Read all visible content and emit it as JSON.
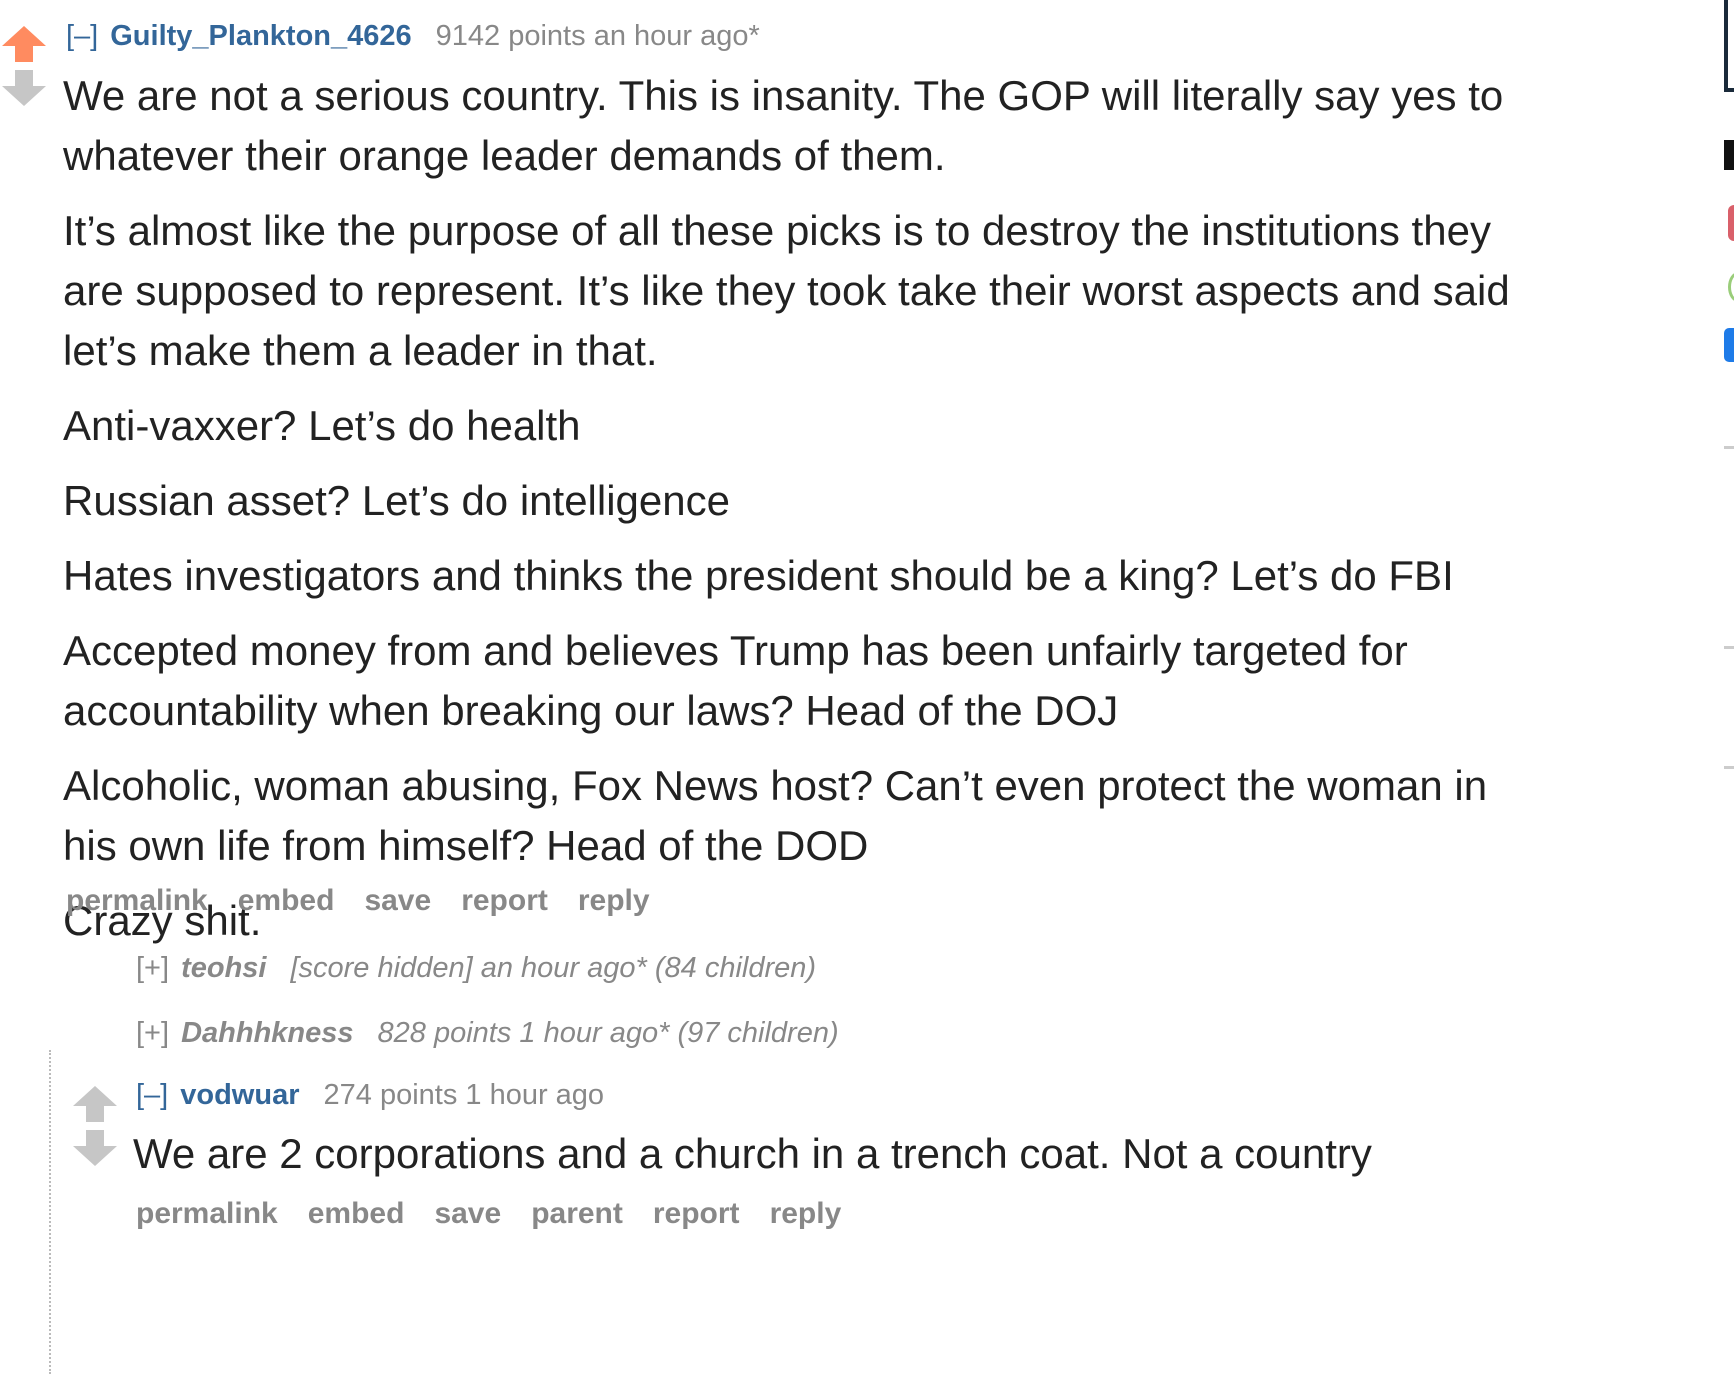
{
  "comment_main": {
    "toggle": "[–]",
    "author": "Guilty_Plankton_4626",
    "score": "9142 points",
    "time": "an hour ago*",
    "paragraphs": [
      "We are not a serious country. This is insanity. The GOP will literally say yes to whatever their orange leader demands of them.",
      "It’s almost like the purpose of all these picks is to destroy the institutions they are supposed to represent. It’s like they took take their worst aspects and said let’s make them a leader in that.",
      "Anti-vaxxer? Let’s do health",
      "Russian asset? Let’s do intelligence",
      "Hates investigators and thinks the president should be a king? Let’s do FBI",
      "Accepted money from and believes Trump has been unfairly targeted for accountability when breaking our laws? Head of the DOJ",
      "Alcoholic, woman abusing, Fox News host? Can’t even protect the woman in his own life from himself? Head of the DOD",
      "Crazy shit."
    ],
    "buttons": [
      "permalink",
      "embed",
      "save",
      "report",
      "reply"
    ]
  },
  "collapsed_1": {
    "toggle": "[+]",
    "author": "teohsi",
    "score": "[score hidden]",
    "time": "an hour ago*",
    "children": "(84 children)"
  },
  "collapsed_2": {
    "toggle": "[+]",
    "author": "Dahhhkness",
    "score": "828 points",
    "time": "1 hour ago*",
    "children": "(97 children)"
  },
  "comment_reply": {
    "toggle": "[–]",
    "author": "vodwuar",
    "score": "274 points",
    "time": "1 hour ago",
    "paragraphs": [
      "We are 2 corporations and a church in a trench coat. Not a country"
    ],
    "buttons": [
      "permalink",
      "embed",
      "save",
      "parent",
      "report",
      "reply"
    ]
  },
  "colors": {
    "upvoted": "#ff8b60",
    "arrow_neutral": "#c6c6c6",
    "link": "#336699",
    "muted": "#888888"
  }
}
